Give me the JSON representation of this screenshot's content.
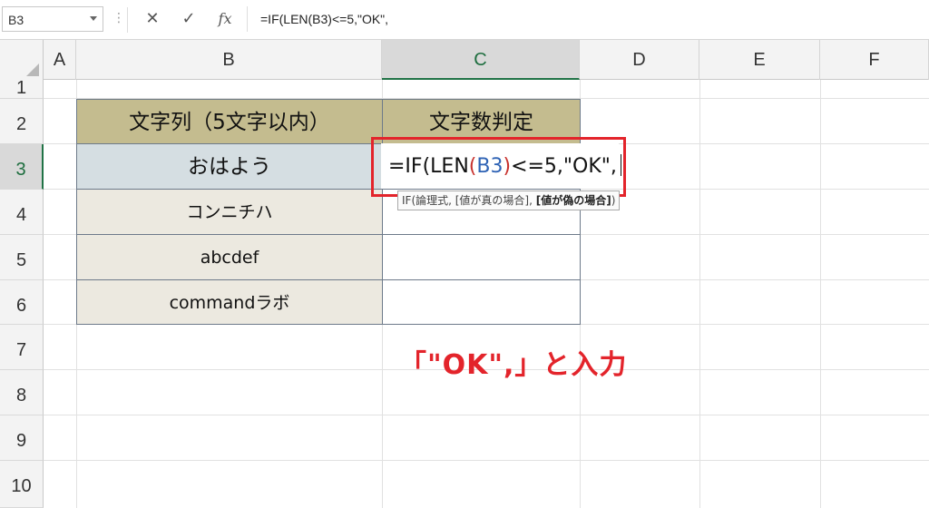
{
  "formula_bar": {
    "name_box": "B3",
    "dots": "⋮",
    "cancel_icon": "✕",
    "enter_icon": "✓",
    "fx_label": "fx",
    "formula": "=IF(LEN(B3)<=5,\"OK\","
  },
  "columns": [
    "A",
    "B",
    "C",
    "D",
    "E",
    "F"
  ],
  "rows": [
    "1",
    "2",
    "3",
    "4",
    "5",
    "6",
    "7",
    "8",
    "9",
    "10"
  ],
  "table": {
    "header_b": "文字列（5文字以内）",
    "header_c": "文字数判定",
    "b_values": [
      "おはよう",
      "コンニチハ",
      "abcdef",
      "commandラボ"
    ]
  },
  "editing_cell": {
    "part1": "=IF(LEN",
    "paren_open": "(",
    "ref": "B3",
    "paren_close": ")",
    "part2": "<=5,\"OK\","
  },
  "tooltip": {
    "text": "IF(論理式, [値が真の場合], ",
    "bold": "[値が偽の場合]",
    "end": ")"
  },
  "annotation": "「\"OK\",」と入力",
  "colors": {
    "header_fill": "#c4bc8f",
    "value_fill": "#ece9e0",
    "selected_fill": "#d5dee2",
    "highlight_red": "#e3242b"
  }
}
